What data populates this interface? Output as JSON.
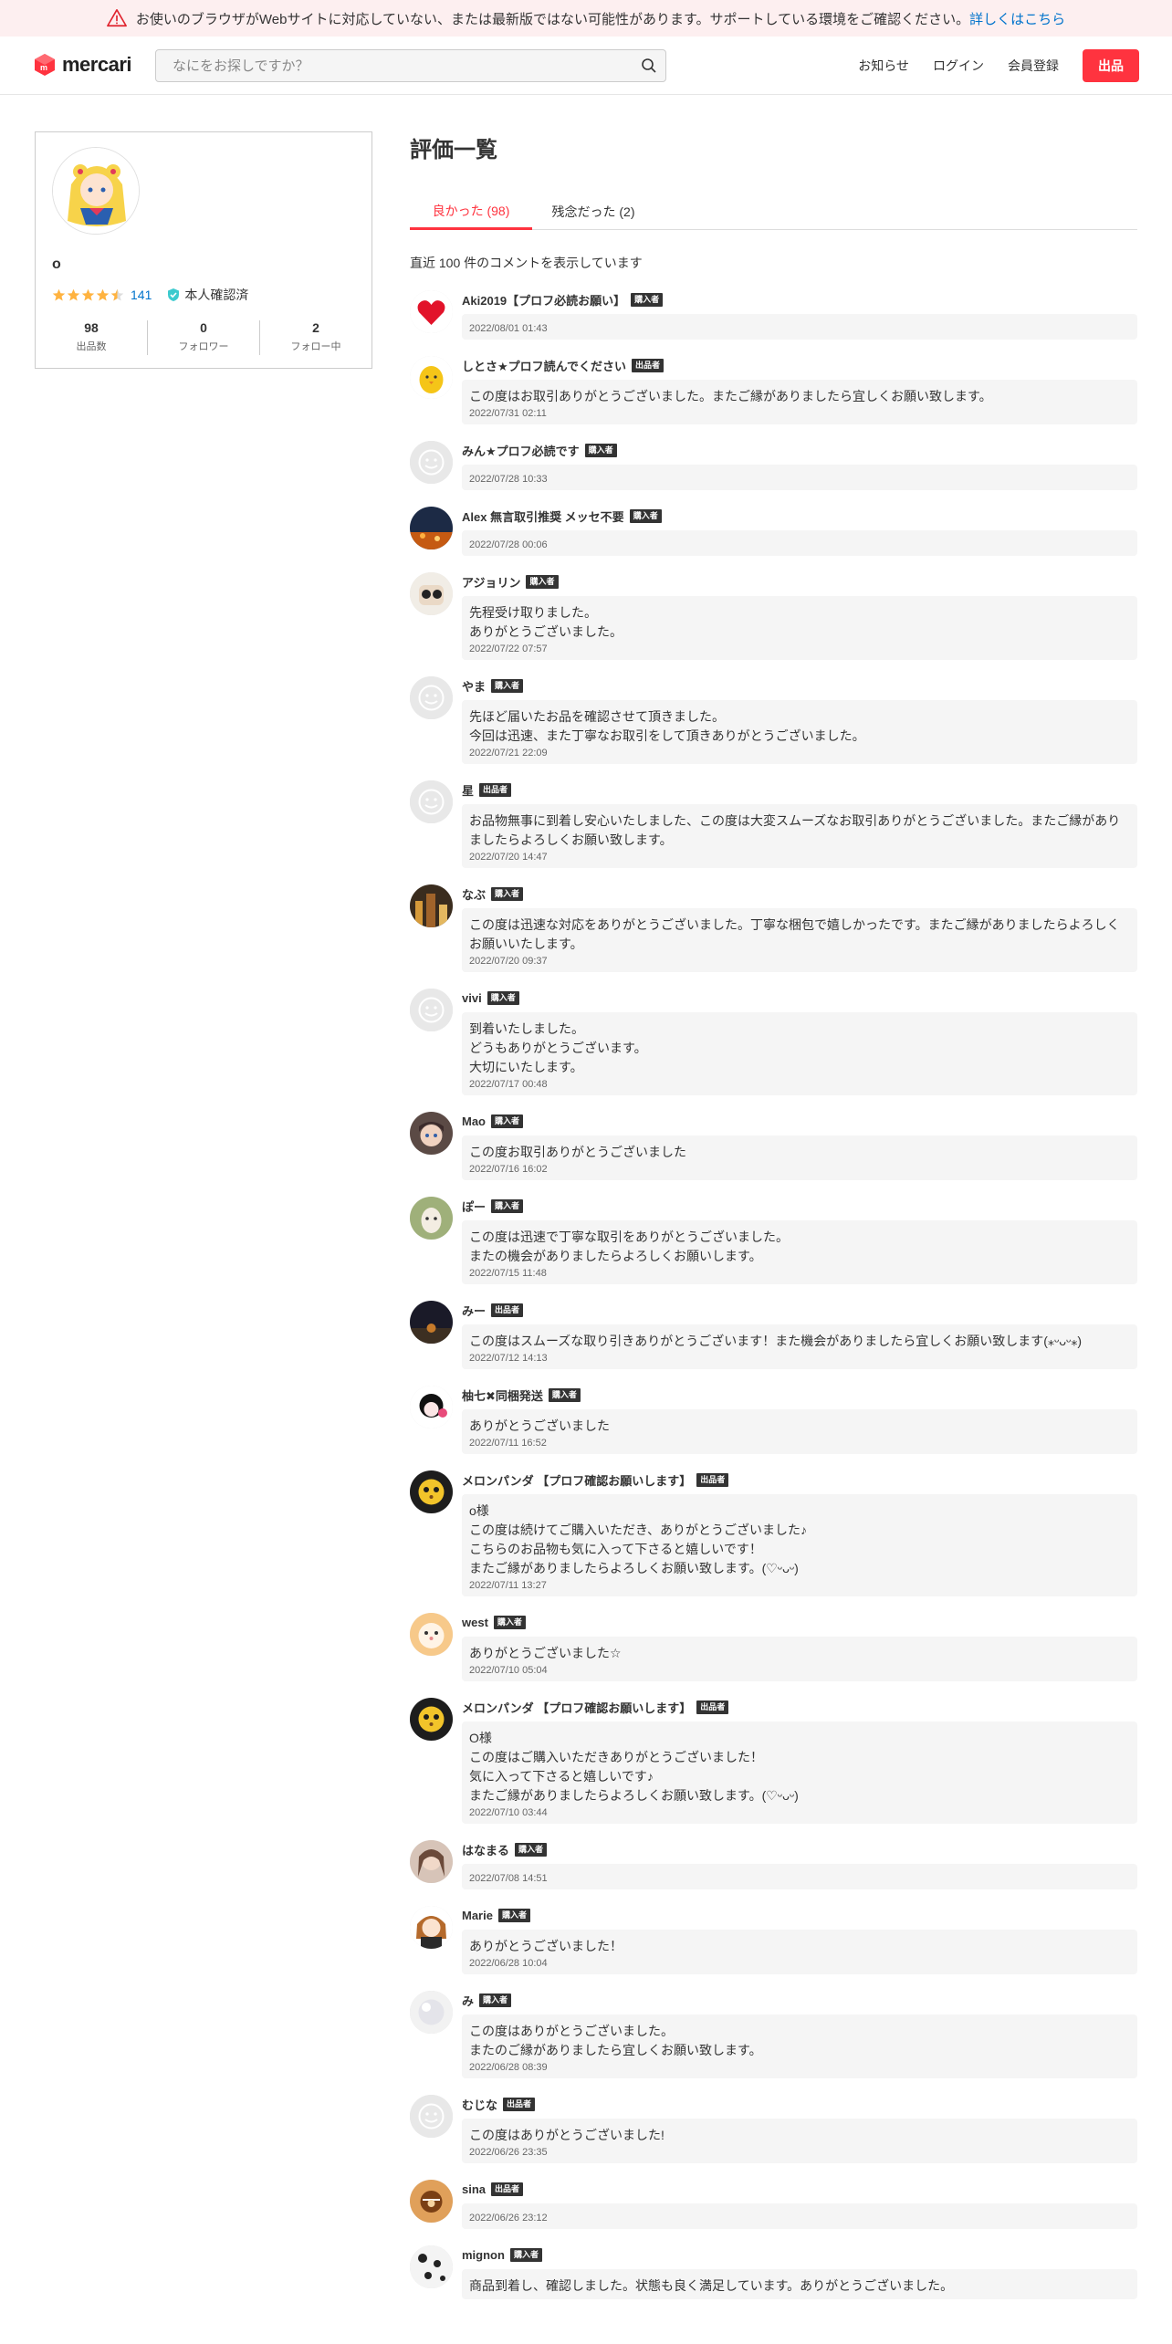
{
  "banner": {
    "message": "お使いのブラウザがWebサイトに対応していない、または最新版ではない可能性があります。サポートしている環境をご確認ください。",
    "link": "詳しくはこちら"
  },
  "header": {
    "logo": "mercari",
    "search_placeholder": "なにをお探しですか？",
    "nav": {
      "news": "お知らせ",
      "login": "ログイン",
      "signup": "会員登録",
      "sell": "出品"
    }
  },
  "profile": {
    "name": "o",
    "rating": 4.5,
    "rating_count": "141",
    "verified": "本人確認済",
    "stats": [
      {
        "value": "98",
        "label": "出品数"
      },
      {
        "value": "0",
        "label": "フォロワー"
      },
      {
        "value": "2",
        "label": "フォロー中"
      }
    ]
  },
  "page": {
    "title": "評価一覧",
    "tabs": {
      "good": "良かった (98)",
      "bad": "残念だった (2)"
    },
    "recent_note": "直近 100 件のコメントを表示しています"
  },
  "colors": {
    "accent": "#ff333f",
    "link": "#0073cc",
    "star": "#ffb340",
    "verified": "#3ccace"
  },
  "reviews": [
    {
      "user": "Aki2019【プロフ必読お願い】",
      "role": "購入者",
      "text": "",
      "date": "2022/08/01 01:43",
      "avatar": "heart"
    },
    {
      "user": "しとさ★プロフ読んでください",
      "role": "出品者",
      "text": "この度はお取引ありがとうございました。またご縁がありましたら宜しくお願い致します。",
      "date": "2022/07/31 02:11",
      "avatar": "chick"
    },
    {
      "user": "みん★プロフ必読です",
      "role": "購入者",
      "text": "",
      "date": "2022/07/28 10:33",
      "avatar": "default"
    },
    {
      "user": "Alex 無言取引推奨 メッセ不要",
      "role": "購入者",
      "text": "",
      "date": "2022/07/28 00:06",
      "avatar": "night"
    },
    {
      "user": "アジョリン",
      "role": "購入者",
      "text": "先程受け取りました。\nありがとうございました。",
      "date": "2022/07/22 07:57",
      "avatar": "glasses"
    },
    {
      "user": "やま",
      "role": "購入者",
      "text": "先ほど届いたお品を確認させて頂きました。\n今回は迅速、また丁寧なお取引をして頂きありがとうございました。",
      "date": "2022/07/21 22:09",
      "avatar": "default"
    },
    {
      "user": "星",
      "role": "出品者",
      "text": "お品物無事に到着し安心いたしました、この度は大変スムーズなお取引ありがとうございました。またご縁がありましたらよろしくお願い致します。",
      "date": "2022/07/20 14:47",
      "avatar": "default"
    },
    {
      "user": "なぶ",
      "role": "購入者",
      "text": "この度は迅速な対応をありがとうございました。丁寧な梱包で嬉しかったです。またご縁がありましたらよろしくお願いいたします。",
      "date": "2022/07/20 09:37",
      "avatar": "city"
    },
    {
      "user": "vivi",
      "role": "購入者",
      "text": "到着いたしました。\nどうもありがとうございます。\n大切にいたします。",
      "date": "2022/07/17 00:48",
      "avatar": "default"
    },
    {
      "user": "Mao",
      "role": "購入者",
      "text": "この度お取引ありがとうございました",
      "date": "2022/07/16 16:02",
      "avatar": "anime"
    },
    {
      "user": "ぽー",
      "role": "購入者",
      "text": "この度は迅速で丁寧な取引をありがとうございました。\nまたの機会がありましたらよろしくお願いします。",
      "date": "2022/07/15 11:48",
      "avatar": "alpaca"
    },
    {
      "user": "みー",
      "role": "出品者",
      "text": "この度はスムーズな取り引きありがとうございます！また機会がありましたら宜しくお願い致します(⁎ᵕᴗᵕ⁎)",
      "date": "2022/07/12 14:13",
      "avatar": "dusk"
    },
    {
      "user": "柚七✖︎同梱発送",
      "role": "購入者",
      "text": "ありがとうございました",
      "date": "2022/07/11 16:52",
      "avatar": "girl"
    },
    {
      "user": "メロンパンダ 【プロフ確認お願いします】",
      "role": "出品者",
      "text": "o様\nこの度は続けてご購入いただき、ありがとうございました♪\nこちらのお品物も気に入って下さると嬉しいです！\nまたご縁がありましたらよろしくお願い致します。(♡ᵕᴗᵕ)",
      "date": "2022/07/11 13:27",
      "avatar": "panda"
    },
    {
      "user": "west",
      "role": "購入者",
      "text": "ありがとうございました☆",
      "date": "2022/07/10 05:04",
      "avatar": "hamster"
    },
    {
      "user": "メロンパンダ 【プロフ確認お願いします】",
      "role": "出品者",
      "text": "O様\nこの度はご購入いただきありがとうございました！\n気に入って下さると嬉しいです♪\nまたご縁がありましたらよろしくお願い致します。(♡ᵕᴗᵕ)",
      "date": "2022/07/10 03:44",
      "avatar": "panda"
    },
    {
      "user": "はなまる",
      "role": "購入者",
      "text": "",
      "date": "2022/07/08 14:51",
      "avatar": "portrait"
    },
    {
      "user": "Marie",
      "role": "購入者",
      "text": "ありがとうございました！",
      "date": "2022/06/28 10:04",
      "avatar": "doll"
    },
    {
      "user": "み",
      "role": "購入者",
      "text": "この度はありがとうございました。\nまたのご縁がありましたら宜しくお願い致します。",
      "date": "2022/06/28 08:39",
      "avatar": "pale"
    },
    {
      "user": "むじな",
      "role": "出品者",
      "text": "この度はありがとうございました!",
      "date": "2022/06/26 23:35",
      "avatar": "default"
    },
    {
      "user": "sina",
      "role": "出品者",
      "text": "",
      "date": "2022/06/26 23:12",
      "avatar": "sina"
    },
    {
      "user": "mignon",
      "role": "購入者",
      "text": "商品到着し、確認しました。状態も良く満足しています。ありがとうございました。",
      "date": "",
      "avatar": "dalmatian"
    }
  ]
}
